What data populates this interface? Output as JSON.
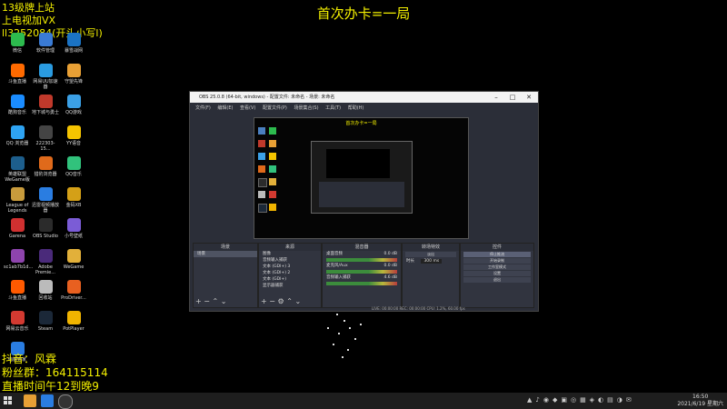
{
  "overlay": {
    "title": "首次办卡=一局",
    "top_left": [
      "13级牌上站",
      "上电视加VX",
      "ll3252084(开头小写l)"
    ],
    "bottom_left": [
      "抖音：风霖",
      "粉丝群：164115114",
      "直播时间午12到晚9"
    ]
  },
  "desktop_icons": [
    {
      "label": "微信",
      "color": "#2dbb4e"
    },
    {
      "label": "软件管理",
      "color": "#3a7bd5"
    },
    {
      "label": "暴雪战网",
      "color": "#1b73c4"
    },
    {
      "label": "斗鱼直播",
      "color": "#ff6a00"
    },
    {
      "label": "网易UU加速器",
      "color": "#2a9be0"
    },
    {
      "label": "守望先锋",
      "color": "#e8a035"
    },
    {
      "label": "酷狗音乐",
      "color": "#1a8cff"
    },
    {
      "label": "地下城与勇士",
      "color": "#c0392b"
    },
    {
      "label": "QQ游戏",
      "color": "#3ba0e6"
    },
    {
      "label": "QQ 浏览器",
      "color": "#2ea3f2"
    },
    {
      "label": "222303-15...",
      "color": "#444"
    },
    {
      "label": "YY语音",
      "color": "#f5c400"
    },
    {
      "label": "英雄联盟 WeGame版",
      "color": "#1d5e8c"
    },
    {
      "label": "猎豹浏览器",
      "color": "#e06a1b"
    },
    {
      "label": "QQ音乐",
      "color": "#31c27c"
    },
    {
      "label": "League of Legends",
      "color": "#c89b3c"
    },
    {
      "label": "迅雷视频播放器",
      "color": "#2a7de1"
    },
    {
      "label": "金码XB",
      "color": "#d4a017"
    },
    {
      "label": "Garena",
      "color": "#d03030"
    },
    {
      "label": "OBS Studio",
      "color": "#2b2b2b"
    },
    {
      "label": "小号壁纸",
      "color": "#7b5cd6"
    },
    {
      "label": "sc1ab7b1d...",
      "color": "#8e44ad"
    },
    {
      "label": "Adobe Premie...",
      "color": "#4a2a7a"
    },
    {
      "label": "WeGame",
      "color": "#e2b03a"
    },
    {
      "label": "斗鱼直播",
      "color": "#ff5a00"
    },
    {
      "label": "回收站",
      "color": "#bbb"
    },
    {
      "label": "ProDriver...",
      "color": "#e86020"
    },
    {
      "label": "网易云音乐",
      "color": "#d33a31"
    },
    {
      "label": "Steam",
      "color": "#1b2838"
    },
    {
      "label": "PotPlayer",
      "color": "#f0b400"
    },
    {
      "label": "电脑管家",
      "color": "#2a7de1"
    }
  ],
  "obs": {
    "title": "OBS 25.0.8 (64-bit, windows) - 配置文件: 未命名 - 场景: 未命名",
    "menu": [
      "文件(F)",
      "编辑(E)",
      "查看(V)",
      "配置文件(P)",
      "场景集合(S)",
      "工具(T)",
      "帮助(H)"
    ],
    "preview_text": "首次办卡=一局",
    "scenes": {
      "header": "场景",
      "items": [
        "场景"
      ]
    },
    "sources": {
      "header": "来源",
      "items": [
        "图像",
        "音频输入捕获",
        "文本 (GDI+) 3",
        "文本 (GDI+) 2",
        "文本 (GDI+)",
        "显示器捕获"
      ]
    },
    "mixer": {
      "header": "混音器",
      "channels": [
        {
          "name": "桌面音频",
          "db": "0.0 dB"
        },
        {
          "name": "麦克风/Aux",
          "db": "0.0 dB"
        },
        {
          "name": "音频输入捕获",
          "db": "4.6 dB"
        }
      ]
    },
    "transitions": {
      "header": "转场特效",
      "type": "淡出",
      "duration_label": "时长",
      "duration": "300 ms"
    },
    "controls": {
      "header": "控件",
      "buttons": [
        "停止推流",
        "开始录制",
        "工作室模式",
        "设置",
        "退出"
      ]
    },
    "status": "LIVE: 00:00:00   REC: 00:00:00   CPU: 1.2%, 60.00 fps"
  },
  "taskbar": {
    "time": "16:50",
    "date": "2021/6/19 星期六"
  }
}
